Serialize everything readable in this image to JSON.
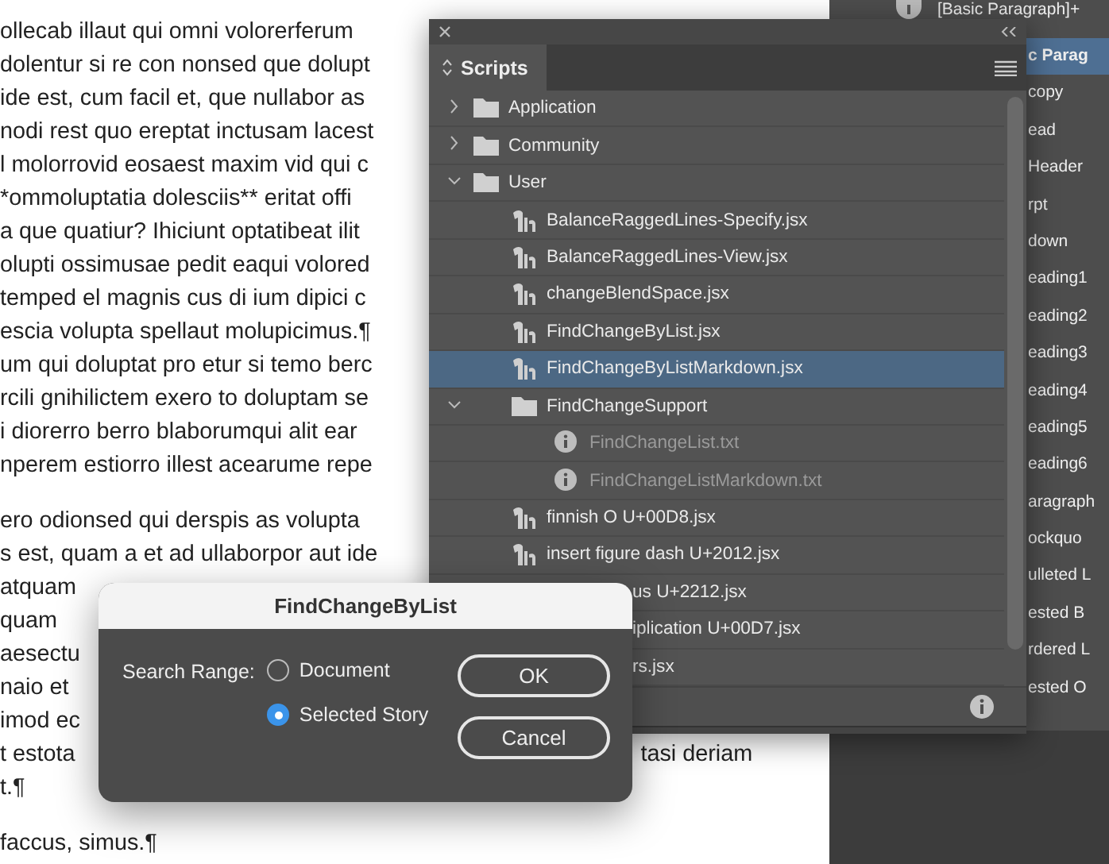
{
  "document": {
    "paragraphs": [
      {
        "lines": [
          [
            "ollecab illaut qui omni volorerferum"
          ],
          [
            "dolentur si re con nonsed que dolupt"
          ],
          [
            "ide est, cum facil et, que nullabor as"
          ],
          [
            "nodi rest quo ereptat inctusam lacest"
          ],
          [
            "l molorrovid eosaest maxim vid qui c"
          ],
          [
            "*ommoluptatia dolesciis** eritat offi"
          ],
          [
            "a que quatiur? Ihiciunt optatibeat ilit"
          ],
          [
            "olupti ossimusae pedit eaqui volored"
          ],
          [
            "temped el magnis cus di ium dipici c"
          ],
          [
            "escia volupta spellaut molupicimus.¶"
          ],
          [
            "um qui doluptat pro etur si temo berc"
          ],
          [
            "rcili gnihilictem exero to doluptam se"
          ],
          [
            "i diorerro berro blaborumqui alit ear"
          ],
          [
            "nperem estiorro illest acearume repe"
          ]
        ]
      },
      {
        "lines": [
          [
            "ero odionsed qui derspis as volupta"
          ],
          [
            "s est, quam a et ad ullaborpor aut ide"
          ],
          [
            "atquam"
          ],
          [
            "quam"
          ],
          [
            "aesectu"
          ],
          [
            "naio et"
          ],
          [
            "imod ec"
          ],
          [
            "t estota",
            "tasi deriam"
          ],
          [
            "t.¶"
          ]
        ]
      },
      {
        "lines": [
          [
            "faccus, simus.¶"
          ]
        ]
      }
    ]
  },
  "styles_panel": {
    "current": "[Basic Paragraph]+",
    "items": [
      {
        "label": "c Parag",
        "selected": true
      },
      {
        "label": "copy",
        "selected": false
      },
      {
        "label": "ead",
        "selected": false
      },
      {
        "label": "Header",
        "selected": false
      },
      {
        "label": "rpt",
        "selected": false
      },
      {
        "label": "down",
        "selected": false
      },
      {
        "label": "eading1",
        "selected": false
      },
      {
        "label": "eading2",
        "selected": false
      },
      {
        "label": "eading3",
        "selected": false
      },
      {
        "label": "eading4",
        "selected": false
      },
      {
        "label": "eading5",
        "selected": false
      },
      {
        "label": "eading6",
        "selected": false
      },
      {
        "label": "aragraph",
        "selected": false
      },
      {
        "label": "ockquo",
        "selected": false
      },
      {
        "label": "ulleted L",
        "selected": false
      },
      {
        "label": "ested B",
        "selected": false
      },
      {
        "label": "rdered L",
        "selected": false
      },
      {
        "label": "ested O",
        "selected": false
      }
    ]
  },
  "scripts_panel": {
    "tab": "Scripts",
    "items": [
      {
        "kind": "folder",
        "label": "Application",
        "expanded": false,
        "selected": false
      },
      {
        "kind": "folder",
        "label": "Community",
        "expanded": false,
        "selected": false
      },
      {
        "kind": "folder",
        "label": "User",
        "expanded": true,
        "selected": false,
        "children": [
          {
            "kind": "script",
            "label": "BalanceRaggedLines-Specify.jsx",
            "selected": false
          },
          {
            "kind": "script",
            "label": "BalanceRaggedLines-View.jsx",
            "selected": false
          },
          {
            "kind": "script",
            "label": "changeBlendSpace.jsx",
            "selected": false
          },
          {
            "kind": "script",
            "label": "FindChangeByList.jsx",
            "selected": false
          },
          {
            "kind": "script",
            "label": "FindChangeByListMarkdown.jsx",
            "selected": true
          },
          {
            "kind": "folder",
            "label": "FindChangeSupport",
            "expanded": true,
            "selected": false,
            "children": [
              {
                "kind": "text_file",
                "label": "FindChangeList.txt",
                "selected": false
              },
              {
                "kind": "text_file",
                "label": "FindChangeListMarkdown.txt",
                "selected": false
              }
            ]
          },
          {
            "kind": "script",
            "label": "finnish O U+00D8.jsx",
            "selected": false
          },
          {
            "kind": "script",
            "label": "insert figure dash U+2012.jsx",
            "selected": false
          },
          {
            "kind": "hidden_start",
            "label": "us U+2212.jsx",
            "selected": false
          },
          {
            "kind": "hidden_start",
            "label": "iplication U+00D7.jsx",
            "selected": false
          },
          {
            "kind": "hidden_start",
            "label": "rs.jsx",
            "selected": false
          }
        ]
      }
    ]
  },
  "dialog": {
    "title": "FindChangeByList",
    "range_label": "Search Range:",
    "options": [
      {
        "label": "Document",
        "selected": false
      },
      {
        "label": "Selected Story",
        "selected": true
      }
    ],
    "buttons": [
      "OK",
      "Cancel"
    ]
  }
}
